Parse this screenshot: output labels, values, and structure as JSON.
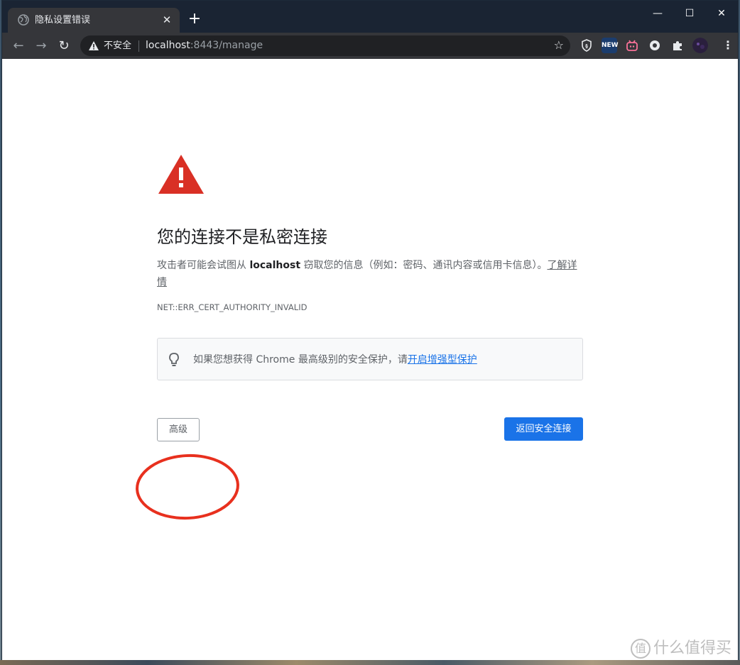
{
  "browser": {
    "tab_title": "隐私设置错误",
    "tab_close": "✕",
    "new_tab": "+",
    "window_controls": {
      "minimize": "—",
      "maximize": "☐",
      "close": "✕"
    },
    "address": {
      "security_label": "不安全",
      "host": "localhost",
      "rest": ":8443/manage"
    },
    "extensions": [
      {
        "name": "shield-extension-icon",
        "label": "",
        "color": "#35363a"
      },
      {
        "name": "new-extension-icon",
        "label": "NEW",
        "color": "#1b3d6e"
      },
      {
        "name": "bilibili-extension-icon",
        "label": "",
        "color": "#35363a"
      },
      {
        "name": "circle-extension-icon",
        "label": "",
        "color": "#35363a"
      },
      {
        "name": "puzzle-extensions-icon",
        "label": "",
        "color": "#35363a"
      }
    ]
  },
  "page": {
    "heading": "您的连接不是私密连接",
    "desc_prefix": "攻击者可能会试图从 ",
    "desc_host": "localhost",
    "desc_suffix": " 窃取您的信息（例如：密码、通讯内容或信用卡信息）。",
    "learn_more": "了解详情",
    "error_code": "NET::ERR_CERT_AUTHORITY_INVALID",
    "tip_text": "如果您想获得 Chrome 最高级别的安全保护，请",
    "tip_link": "开启增强型保护",
    "advanced_button": "高级",
    "back_button": "返回安全连接"
  },
  "watermark": {
    "logo": "值",
    "text": "什么值得买"
  },
  "colors": {
    "primary_blue": "#1a73e8",
    "warning_red": "#d93025",
    "annotation_red": "#e8301e"
  }
}
